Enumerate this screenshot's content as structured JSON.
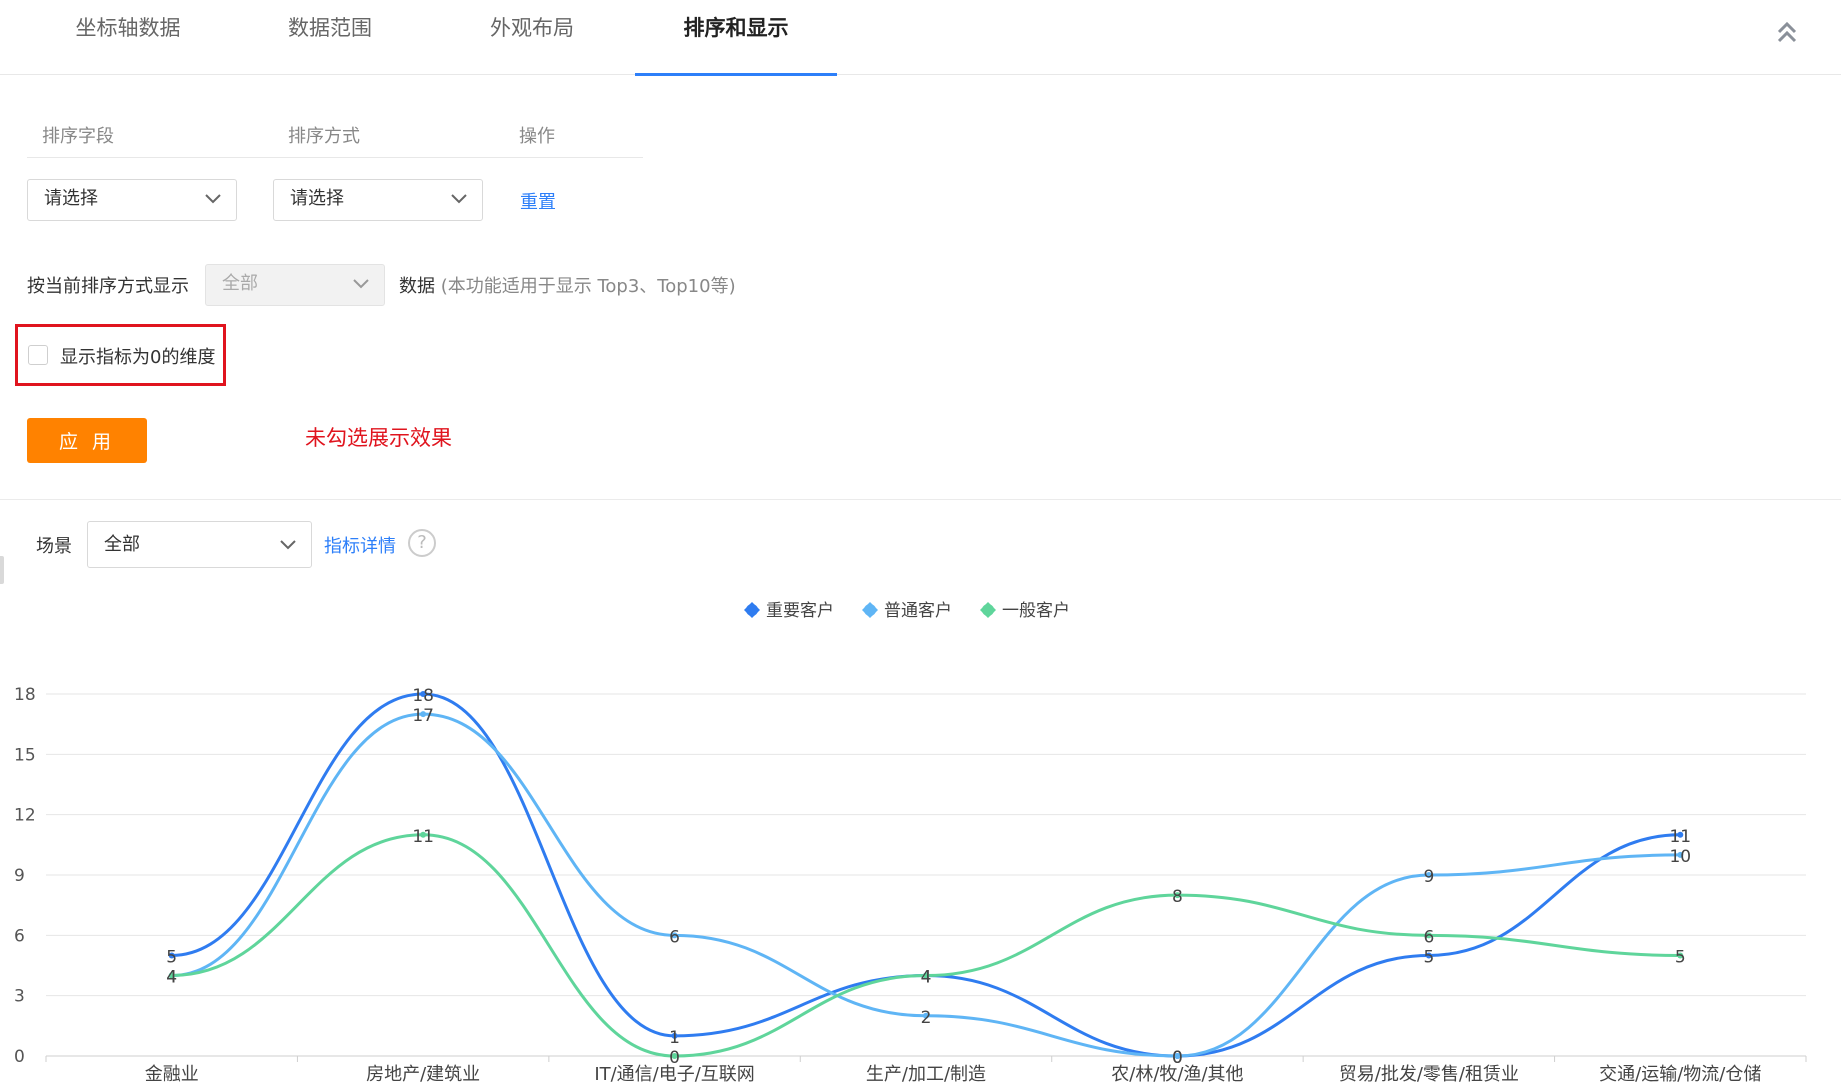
{
  "tabs": [
    {
      "label": "坐标轴数据",
      "active": false
    },
    {
      "label": "数据范围",
      "active": false
    },
    {
      "label": "外观布局",
      "active": false
    },
    {
      "label": "排序和显示",
      "active": true
    }
  ],
  "sort": {
    "headers": {
      "field": "排序字段",
      "method": "排序方式",
      "action": "操作"
    },
    "field_select": "请选择",
    "method_select": "请选择",
    "reset_label": "重置"
  },
  "display": {
    "prefix": "按当前排序方式显示",
    "select_value": "全部",
    "suffix": "数据",
    "hint": "(本功能适用于显示 Top3、Top10等)"
  },
  "zero_dim": {
    "label": "显示指标为0的维度",
    "checked": false
  },
  "apply_label": "应 用",
  "annotation": "未勾选展示效果",
  "scene": {
    "label": "场景",
    "select_value": "全部",
    "detail_link": "指标详情",
    "help_glyph": "?"
  },
  "colors": {
    "accent": "#2d7ff9",
    "apply": "#ff8200",
    "highlight": "#e0141e"
  },
  "chart_data": {
    "type": "line",
    "smooth": true,
    "categories": [
      "金融业",
      "房地产/建筑业",
      "IT/通信/电子/互联网",
      "生产/加工/制造",
      "农/林/牧/渔/其他",
      "贸易/批发/零售/租赁业",
      "交通/运输/物流/仓储"
    ],
    "series": [
      {
        "name": "重要客户",
        "color": "#2f7cf0",
        "values": [
          5,
          18,
          1,
          4,
          0,
          5,
          11
        ]
      },
      {
        "name": "普通客户",
        "color": "#5fb5f5",
        "values": [
          4,
          17,
          6,
          2,
          0,
          9,
          10
        ]
      },
      {
        "name": "一般客户",
        "color": "#5fd59b",
        "values": [
          4,
          11,
          0,
          4,
          8,
          6,
          5
        ]
      }
    ],
    "yticks": [
      0,
      3,
      6,
      9,
      12,
      15,
      18
    ],
    "ylim": [
      0,
      18
    ],
    "grid": true,
    "legend": "top-center",
    "data_labels": true
  }
}
